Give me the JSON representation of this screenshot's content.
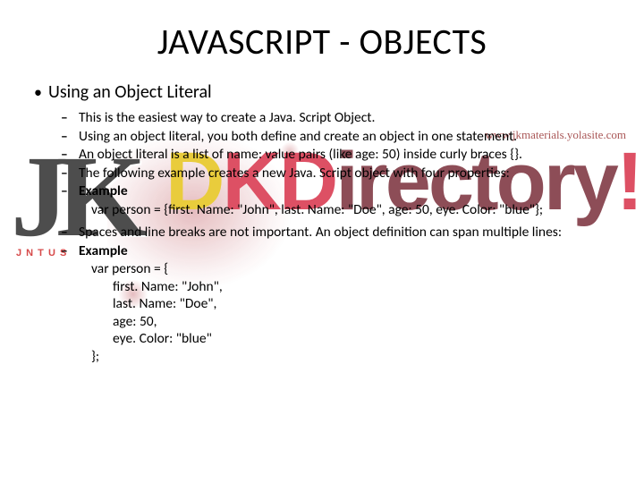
{
  "title": "JAVASCRIPT - OBJECTS",
  "watermark": {
    "logo_letters": "JK",
    "logo_sub": "J N T U  S",
    "big_text_parts": [
      "D",
      "KD",
      "irectory",
      "!"
    ],
    "url": "www.jkmaterials.yolasite.com"
  },
  "bullet_lvl1": "Using an Object Literal",
  "items": {
    "i0": "This is the easiest way to create a Java. Script Object.",
    "i1": "Using an object literal, you both define and create an object in one statement.",
    "i2": "An object literal is a list of name: value pairs (like age: 50) inside curly braces {}.",
    "i3": "The following example creates a new Java. Script object with four properties:",
    "i4": "Example",
    "i5": "Spaces and line breaks are not important. An object definition can span multiple lines:",
    "i6": "Example"
  },
  "example1": {
    "line": "var person = {first. Name: \"John\", last. Name: \"Doe\", age: 50, eye. Color: \"blue\"};"
  },
  "example2": {
    "l0": "var person = {",
    "l1": "first. Name: \"John\",",
    "l2": "last. Name: \"Doe\",",
    "l3": "age: 50,",
    "l4": "eye. Color: \"blue\"",
    "l5": "};"
  }
}
